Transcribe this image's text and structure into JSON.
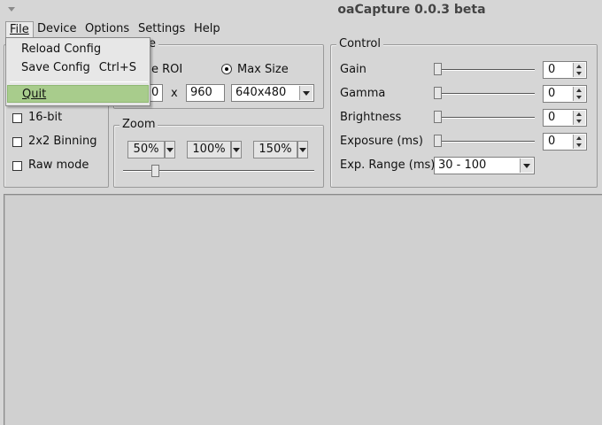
{
  "window": {
    "title": "oaCapture 0.0.3 beta"
  },
  "menubar": {
    "file": "File",
    "device": "Device",
    "options": "Options",
    "settings": "Settings",
    "help": "Help"
  },
  "file_menu": {
    "reload_config": "Reload Config",
    "save_config": "Save Config",
    "save_config_shortcut": "Ctrl+S",
    "quit": "Quit"
  },
  "image_group": {
    "title_partial": "e",
    "use_roi_label_partial": "e ROI",
    "max_size_label": "Max Size",
    "max_size_checked": true,
    "x_separator": "x",
    "width_value_partial": "0",
    "height_value": "960",
    "resolution_selected": "640x480"
  },
  "format_options": {
    "sixteen_bit": "16-bit",
    "binning": "2x2 Binning",
    "raw_mode": "Raw mode"
  },
  "zoom_group": {
    "title": "Zoom",
    "btn_50": "50%",
    "btn_100": "100%",
    "btn_150": "150%",
    "slider_value_fraction": 0.17
  },
  "control_group": {
    "title": "Control",
    "gain": {
      "label": "Gain",
      "value": "0"
    },
    "gamma": {
      "label": "Gamma",
      "value": "0"
    },
    "brightness": {
      "label": "Brightness",
      "value": "0"
    },
    "exposure": {
      "label": "Exposure (ms)",
      "value": "0"
    },
    "exp_range": {
      "label": "Exp. Range (ms)",
      "selected": "30 - 100"
    }
  },
  "colors": {
    "window_bg": "#d6d6d6",
    "menu_highlight": "#a8cc8c"
  }
}
